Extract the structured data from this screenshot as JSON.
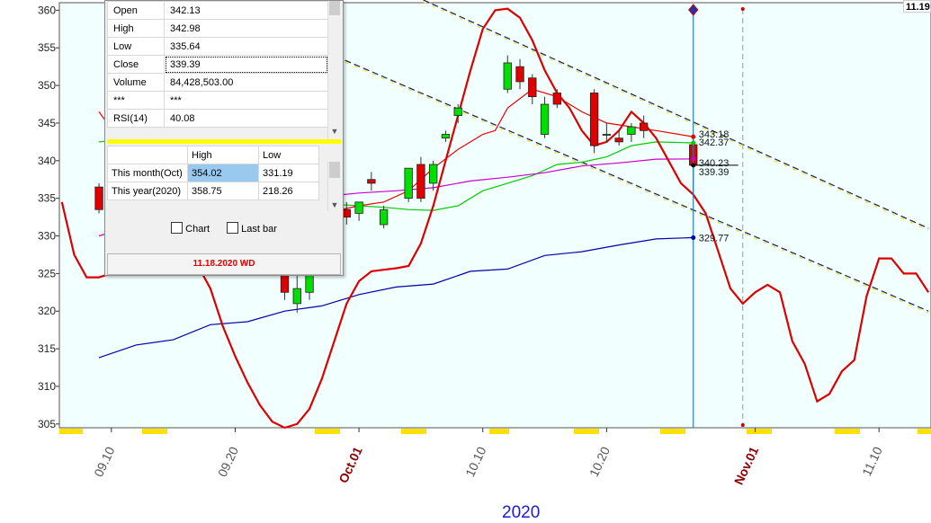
{
  "corner_label": "11.19",
  "info_panel": {
    "ohlc": [
      {
        "key": "Open",
        "value": "342.13"
      },
      {
        "key": "High",
        "value": "342.98"
      },
      {
        "key": "Low",
        "value": "335.64"
      },
      {
        "key": "Close",
        "value": "339.39"
      },
      {
        "key": "Volume",
        "value": "84,428,503.00"
      },
      {
        "key": "***",
        "value": "***"
      },
      {
        "key": "RSI(14)",
        "value": "40.08"
      }
    ],
    "hl_header": {
      "high": "High",
      "low": "Low"
    },
    "hl_rows": [
      {
        "label": "This month(Oct)",
        "high": "354.02",
        "low": "331.19"
      },
      {
        "label": "This year(2020)",
        "high": "358.75",
        "low": "218.26"
      }
    ],
    "chart_checkbox": "Chart",
    "lastbar_checkbox": "Last bar",
    "date": "11.18.2020 WD"
  },
  "chart_data": {
    "type": "line",
    "year_label": "2020",
    "ylim": [
      304.5,
      361
    ],
    "y_ticks": [
      305,
      310,
      315,
      320,
      325,
      330,
      335,
      340,
      345,
      350,
      355,
      360
    ],
    "x_tick_labels": [
      "09.10",
      "09.20",
      "Oct.01",
      "10.10",
      "10.20",
      "Nov.01",
      "11.10"
    ],
    "x_tick_month": [
      false,
      false,
      true,
      false,
      false,
      true,
      false
    ],
    "x_tick_index": [
      4,
      14,
      24,
      34,
      44,
      56,
      66
    ],
    "x_range": [
      -0.2,
      70.2
    ],
    "cursor_index": 51,
    "future_index": 55,
    "candles": [
      {
        "i": 3,
        "o": 336.5,
        "h": 337,
        "l": 333,
        "c": 333.5
      },
      {
        "i": 18,
        "o": 325,
        "h": 326.5,
        "l": 321.5,
        "c": 322.5
      },
      {
        "i": 19,
        "o": 321,
        "h": 325.5,
        "l": 319.8,
        "c": 323
      },
      {
        "i": 20,
        "o": 322.5,
        "h": 326.5,
        "l": 321.5,
        "c": 325.5
      },
      {
        "i": 21,
        "o": 333,
        "h": 334.5,
        "l": 332.5,
        "c": 334
      },
      {
        "i": 22,
        "o": 334,
        "h": 335,
        "l": 333.5,
        "c": 333.5
      },
      {
        "i": 23,
        "o": 333.5,
        "h": 334.5,
        "l": 331.5,
        "c": 332.5
      },
      {
        "i": 24,
        "o": 333,
        "h": 334.5,
        "l": 332,
        "c": 334.5
      },
      {
        "i": 25,
        "o": 337.5,
        "h": 338.5,
        "l": 336,
        "c": 337
      },
      {
        "i": 26,
        "o": 331.5,
        "h": 334,
        "l": 331,
        "c": 333.5
      },
      {
        "i": 28,
        "o": 335,
        "h": 339,
        "l": 334.5,
        "c": 339
      },
      {
        "i": 29,
        "o": 339.5,
        "h": 340.5,
        "l": 334.5,
        "c": 335
      },
      {
        "i": 30,
        "o": 337,
        "h": 340,
        "l": 336,
        "c": 339.5
      },
      {
        "i": 31,
        "o": 343,
        "h": 344,
        "l": 342.5,
        "c": 343.5
      },
      {
        "i": 32,
        "o": 346,
        "h": 347.5,
        "l": 345,
        "c": 347
      },
      {
        "i": 36,
        "o": 349.5,
        "h": 354,
        "l": 349,
        "c": 353
      },
      {
        "i": 37,
        "o": 352.5,
        "h": 353.5,
        "l": 349.5,
        "c": 350.5
      },
      {
        "i": 38,
        "o": 351,
        "h": 351.5,
        "l": 347.5,
        "c": 348.5
      },
      {
        "i": 39,
        "o": 343.5,
        "h": 348.5,
        "l": 343,
        "c": 347.5
      },
      {
        "i": 40,
        "o": 349,
        "h": 349.5,
        "l": 347,
        "c": 347.5
      },
      {
        "i": 43,
        "o": 349,
        "h": 349.5,
        "l": 341,
        "c": 342
      },
      {
        "i": 44,
        "o": 343.5,
        "h": 345,
        "l": 342.5,
        "c": 343.5
      },
      {
        "i": 45,
        "o": 343,
        "h": 344,
        "l": 342,
        "c": 342.5
      },
      {
        "i": 46,
        "o": 343.5,
        "h": 345,
        "l": 342.5,
        "c": 344.5
      },
      {
        "i": 47,
        "o": 345,
        "h": 346,
        "l": 343,
        "c": 344
      },
      {
        "i": 51,
        "o": 342.13,
        "h": 342.98,
        "l": 335.64,
        "c": 339.39
      }
    ],
    "series": [
      {
        "name": "",
        "color": "#0000aa",
        "points": [
          [
            3,
            313.8
          ],
          [
            6,
            315.5
          ],
          [
            9,
            316.2
          ],
          [
            12,
            318.2
          ],
          [
            15,
            318.6
          ],
          [
            18,
            320
          ],
          [
            21,
            320.7
          ],
          [
            24,
            322.2
          ],
          [
            27,
            323.2
          ],
          [
            30,
            323.6
          ],
          [
            33,
            325.3
          ],
          [
            36,
            325.6
          ],
          [
            39,
            327.4
          ],
          [
            42,
            327.9
          ],
          [
            45,
            328.8
          ],
          [
            48,
            329.6
          ],
          [
            51,
            329.77
          ]
        ]
      },
      {
        "name": "",
        "color": "#00cc00",
        "points": [
          [
            3,
            342.5
          ],
          [
            6,
            343
          ],
          [
            9,
            342.5
          ],
          [
            12,
            340
          ],
          [
            15,
            338.5
          ],
          [
            18,
            336.5
          ],
          [
            20,
            335.2
          ],
          [
            22,
            334.2
          ],
          [
            24,
            334
          ],
          [
            26,
            333.8
          ],
          [
            28,
            333.5
          ],
          [
            30,
            333.4
          ],
          [
            32,
            334
          ],
          [
            34,
            336
          ],
          [
            36,
            337
          ],
          [
            38,
            338
          ],
          [
            40,
            339.5
          ],
          [
            42,
            339.8
          ],
          [
            44,
            340.5
          ],
          [
            46,
            342
          ],
          [
            48,
            342.5
          ],
          [
            51,
            342.37
          ]
        ]
      },
      {
        "name": "",
        "color": "#cc00cc",
        "points": [
          [
            3,
            330
          ],
          [
            6,
            331.5
          ],
          [
            9,
            332.5
          ],
          [
            12,
            333.8
          ],
          [
            15,
            334.3
          ],
          [
            18,
            334.6
          ],
          [
            21,
            335.2
          ],
          [
            24,
            335.7
          ],
          [
            27,
            336
          ],
          [
            30,
            336.4
          ],
          [
            33,
            337.3
          ],
          [
            36,
            337.8
          ],
          [
            39,
            338.4
          ],
          [
            42,
            339.3
          ],
          [
            45,
            339.7
          ],
          [
            48,
            340.2
          ],
          [
            51,
            340.23
          ]
        ]
      },
      {
        "name": "",
        "color": "#ee0000",
        "points": [
          [
            3,
            346.5
          ],
          [
            5,
            342
          ],
          [
            8,
            338
          ],
          [
            11,
            337
          ],
          [
            14,
            336
          ],
          [
            17,
            334
          ],
          [
            20,
            333.5
          ],
          [
            22,
            333.3
          ],
          [
            24,
            334
          ],
          [
            26,
            334.5
          ],
          [
            28,
            336
          ],
          [
            30,
            339
          ],
          [
            32,
            341.5
          ],
          [
            34,
            343.5
          ],
          [
            35,
            344
          ],
          [
            36,
            347
          ],
          [
            38,
            349.5
          ],
          [
            40,
            348.5
          ],
          [
            42,
            346.5
          ],
          [
            44,
            345
          ],
          [
            46,
            344.5
          ],
          [
            48,
            344
          ],
          [
            51,
            343.18
          ]
        ]
      },
      {
        "name": "",
        "color": "#dd0000",
        "points": [
          [
            0,
            334.5
          ],
          [
            1,
            327.5
          ],
          [
            2,
            324.5
          ],
          [
            3,
            324.5
          ],
          [
            4,
            325
          ],
          [
            5,
            327.5
          ],
          [
            6,
            330
          ],
          [
            7,
            332
          ],
          [
            8,
            331.5
          ],
          [
            9,
            329
          ],
          [
            11,
            326
          ],
          [
            12,
            323
          ],
          [
            13,
            318
          ],
          [
            14,
            314
          ],
          [
            15,
            310.5
          ],
          [
            16,
            307.5
          ],
          [
            17,
            305.3
          ],
          [
            18,
            304.5
          ],
          [
            19,
            305
          ],
          [
            20,
            307
          ],
          [
            21,
            311
          ],
          [
            22,
            316
          ],
          [
            23,
            321
          ],
          [
            24,
            324
          ],
          [
            25,
            325.3
          ],
          [
            26,
            325.5
          ],
          [
            27,
            325.7
          ],
          [
            28,
            326
          ],
          [
            29,
            329
          ],
          [
            30,
            334
          ],
          [
            31,
            340
          ],
          [
            32,
            346
          ],
          [
            33,
            352
          ],
          [
            34,
            357.5
          ],
          [
            35,
            360
          ],
          [
            36,
            360.2
          ],
          [
            37,
            359
          ],
          [
            38,
            356
          ],
          [
            39,
            352
          ],
          [
            40,
            349
          ],
          [
            41,
            347
          ],
          [
            42,
            344
          ],
          [
            43,
            342
          ],
          [
            44,
            342.5
          ],
          [
            45,
            344
          ],
          [
            46,
            346.5
          ],
          [
            47,
            345
          ],
          [
            48,
            343
          ],
          [
            49,
            340
          ],
          [
            50,
            337
          ],
          [
            51,
            335.5
          ],
          [
            52,
            333
          ],
          [
            53,
            328
          ],
          [
            54,
            323
          ],
          [
            55,
            321
          ],
          [
            56,
            322.5
          ],
          [
            57,
            323.5
          ],
          [
            58,
            322.5
          ],
          [
            59,
            316
          ],
          [
            60,
            313
          ],
          [
            61,
            308
          ],
          [
            62,
            309
          ],
          [
            63,
            312
          ],
          [
            64,
            313.5
          ],
          [
            65,
            322
          ],
          [
            66,
            327
          ],
          [
            67,
            327
          ],
          [
            68,
            325
          ],
          [
            69,
            325
          ],
          [
            70,
            322.5
          ]
        ]
      }
    ],
    "trendlines": [
      {
        "from": [
          27,
          363
        ],
        "to": [
          70,
          331
        ]
      },
      {
        "from": [
          17,
          357.5
        ],
        "to": [
          70,
          320
        ]
      }
    ],
    "price_labels": [
      {
        "text": "343.18",
        "y": 343.18,
        "color": "#ee0000"
      },
      {
        "text": "342.37",
        "y": 342.37,
        "color": "#00cc00"
      },
      {
        "text": "340.23",
        "y": 340.23,
        "color": "#cc00cc"
      },
      {
        "text": "339.39",
        "y": 339.39,
        "color": "#000000"
      },
      {
        "text": "329.77",
        "y": 329.77,
        "color": "#0000aa"
      }
    ]
  }
}
